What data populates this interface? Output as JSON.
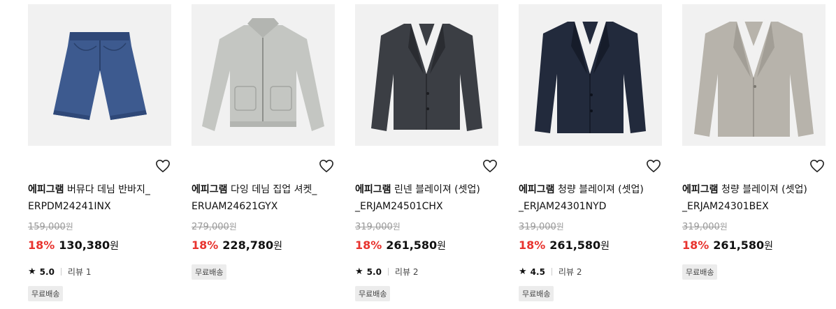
{
  "products": [
    {
      "brand": "에피그램",
      "name": "버뮤다 데님 반바지_",
      "code": "ERPDM24241INX",
      "original_price": "159,000",
      "currency": "원",
      "discount_rate": "18%",
      "price": "130,380",
      "star_icon": "star-icon",
      "rating": "5.0",
      "reviews": "리뷰 1",
      "badge": "무료배송",
      "image": "denim-shorts",
      "colors": {
        "main": "#3d5a8f",
        "shade": "#2f4878"
      }
    },
    {
      "brand": "에피그램",
      "name": "다잉 데님 집업 셔켓_",
      "code": "ERUAM24621GYX",
      "original_price": "279,000",
      "currency": "원",
      "discount_rate": "18%",
      "price": "228,780",
      "badge": "무료배송",
      "image": "zip-shirt-jacket",
      "colors": {
        "main": "#c4c6c2",
        "shade": "#a9aba7"
      }
    },
    {
      "brand": "에피그램",
      "name": "린넨 블레이져 (셋업)",
      "code": "_ERJAM24501CHX",
      "original_price": "319,000",
      "currency": "원",
      "discount_rate": "18%",
      "price": "261,580",
      "star_icon": "star-icon",
      "rating": "5.0",
      "reviews": "리뷰 2",
      "badge": "무료배송",
      "image": "charcoal-blazer",
      "colors": {
        "main": "#3b3e44",
        "shade": "#2a2c31"
      }
    },
    {
      "brand": "에피그램",
      "name": "청량 블레이져 (셋업)",
      "code": "_ERJAM24301NYD",
      "original_price": "319,000",
      "currency": "원",
      "discount_rate": "18%",
      "price": "261,580",
      "star_icon": "star-icon",
      "rating": "4.5",
      "reviews": "리뷰 2",
      "badge": "무료배송",
      "image": "navy-blazer",
      "colors": {
        "main": "#222a3c",
        "shade": "#161c2a"
      }
    },
    {
      "brand": "에피그램",
      "name": "청량 블레이져 (셋업)",
      "code": "_ERJAM24301BEX",
      "original_price": "319,000",
      "currency": "원",
      "discount_rate": "18%",
      "price": "261,580",
      "badge": "무료배송",
      "image": "beige-blazer",
      "colors": {
        "main": "#b7b3ab",
        "shade": "#9e9a92"
      }
    }
  ],
  "ui": {
    "wishlist_icon": "heart-outline-icon",
    "accent_color": "#e8332e"
  }
}
